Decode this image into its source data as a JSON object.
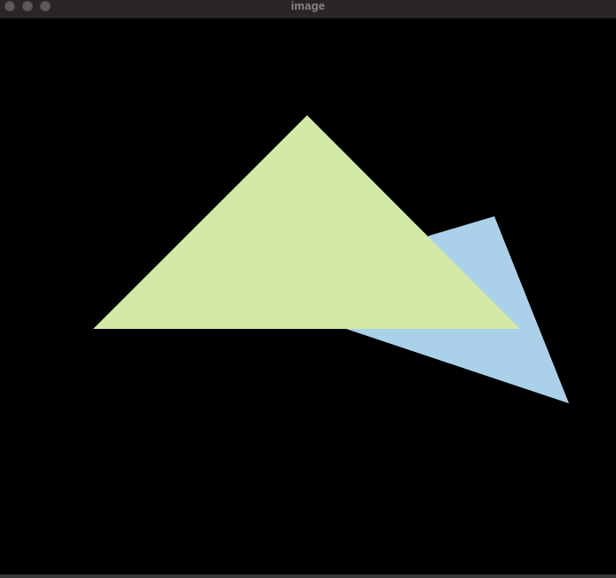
{
  "window": {
    "title": "image"
  },
  "titlebar": {
    "buttons": [
      "close-button",
      "minimize-button",
      "zoom-button"
    ]
  },
  "canvas": {
    "background": "#000000",
    "shapes": [
      {
        "name": "blue-triangle",
        "color": "#abd0ea"
      },
      {
        "name": "green-triangle",
        "color": "#d2e9a7"
      }
    ]
  }
}
